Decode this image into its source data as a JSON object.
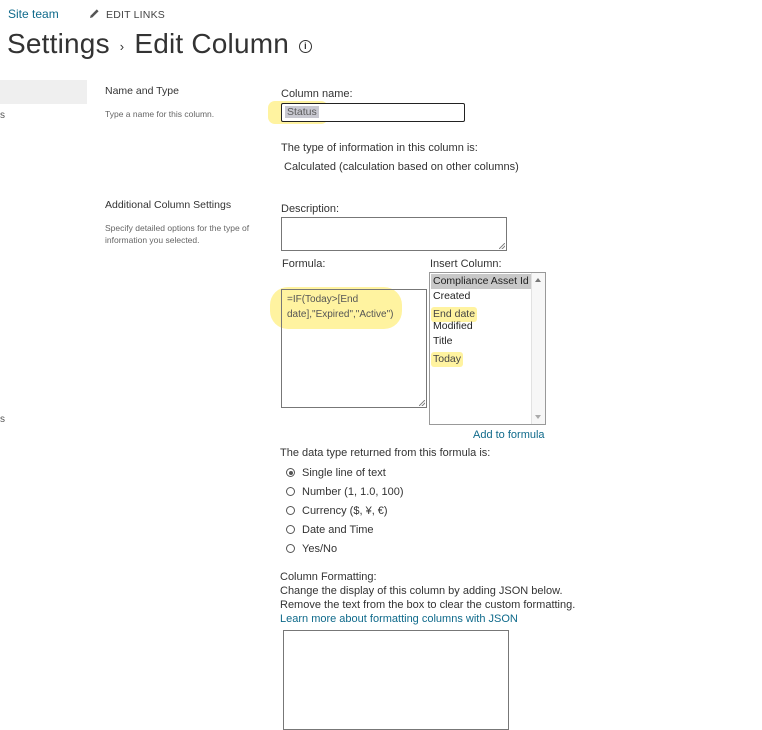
{
  "topbar": {
    "site_link": "Site team",
    "edit_links": "EDIT LINKS"
  },
  "header": {
    "breadcrumb_root": "Settings",
    "separator": "›",
    "title": "Edit Column",
    "info_glyph": "i"
  },
  "left_nav": {
    "fragment_1": "s",
    "fragment_2": "s"
  },
  "sections": {
    "name_type": {
      "title": "Name and Type",
      "description": "Type a name for this column."
    },
    "additional": {
      "title": "Additional Column Settings",
      "description": "Specify detailed options for the type of information you selected."
    }
  },
  "form": {
    "column_name_label": "Column name:",
    "column_name_value": "Status",
    "type_info_label": "The type of information in this column is:",
    "type_info_value": "Calculated (calculation based on other columns)",
    "description_label": "Description:",
    "description_value": "",
    "formula_label": "Formula:",
    "formula_line1": "=IF(Today>[End",
    "formula_line2": "date],\"Expired\",\"Active\")",
    "insert_column_label": "Insert Column:",
    "insert_column_options": [
      "Compliance Asset Id",
      "Created",
      "End date",
      "Modified",
      "Title",
      "Today"
    ],
    "insert_column_selected": "Compliance Asset Id",
    "add_to_formula": "Add to formula",
    "return_type_label": "The data type returned from this formula is:",
    "return_types": [
      "Single line of text",
      "Number (1, 1.0, 100)",
      "Currency ($, ¥, €)",
      "Date and Time",
      "Yes/No"
    ],
    "return_type_selected": "Single line of text",
    "formatting_label": "Column Formatting:",
    "formatting_line1": "Change the display of this column by adding JSON below.",
    "formatting_line2": "Remove the text from the box to clear the custom formatting.",
    "formatting_link": "Learn more about formatting columns with JSON"
  },
  "icons": {
    "edit": "pencil-icon",
    "info": "info-icon"
  },
  "colors": {
    "link": "#0f6a8b",
    "highlight": "#fff3a0",
    "selection": "#c8c8d0"
  }
}
